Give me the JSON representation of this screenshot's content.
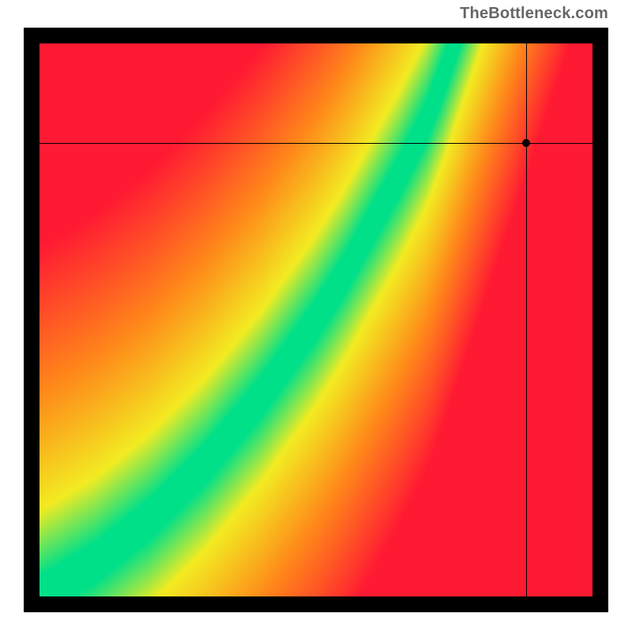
{
  "watermark": "TheBottleneck.com",
  "chart_data": {
    "type": "heatmap",
    "title": "",
    "xlabel": "",
    "ylabel": "",
    "xlim": [
      0,
      100
    ],
    "ylim": [
      0,
      100
    ],
    "colorscale_description": "red -> orange -> yellow -> green along ridge; ridge is optimal match line",
    "ridge_points_xy": [
      [
        0,
        0
      ],
      [
        10,
        6
      ],
      [
        20,
        14
      ],
      [
        30,
        24
      ],
      [
        40,
        36
      ],
      [
        50,
        50
      ],
      [
        55,
        58
      ],
      [
        60,
        67
      ],
      [
        65,
        76
      ],
      [
        70,
        86
      ],
      [
        73,
        94
      ],
      [
        75,
        100
      ]
    ],
    "ridge_width_percent": 7,
    "crosshair": {
      "x": 88,
      "y": 82
    },
    "annotations": []
  },
  "colors": {
    "red": "#ff1a33",
    "orange": "#ff8a1a",
    "yellow": "#f3ec22",
    "green": "#00e08a",
    "frame": "#000000",
    "watermark": "#666666",
    "marker": "#000000"
  }
}
